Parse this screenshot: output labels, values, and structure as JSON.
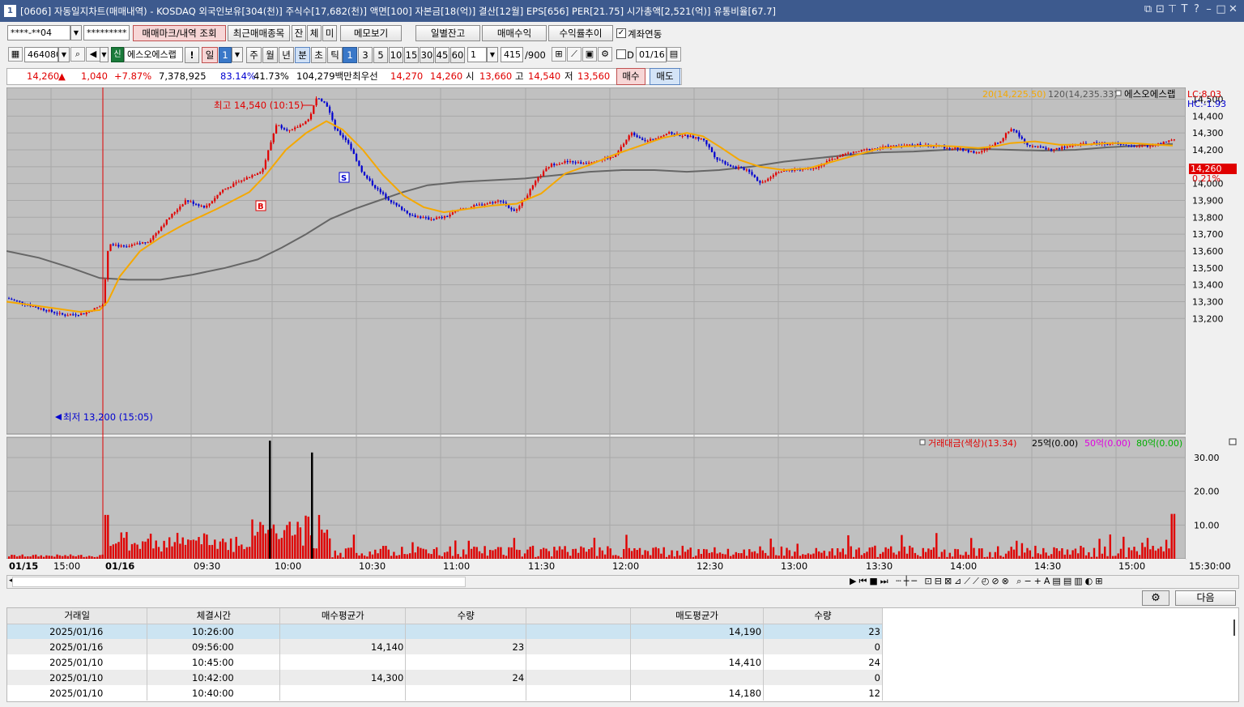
{
  "window": {
    "title": "[0606] 자동일지차트(매매내역) - KOSDAQ 외국인보유[304(천)] 주식수[17,682(천)] 액면[100] 자본금[18(억)] 결산[12월] EPS[656] PER[21.75] 시가총액[2,521(억)] 유통비율[67.7]",
    "app_icon": "1"
  },
  "toolbar1": {
    "account": "****-**04",
    "password": "*********",
    "btn_mark": "매매마크/내역 조회",
    "btn_recent": "최근매매종목",
    "btn_jan": "잔",
    "btn_che": "체",
    "btn_mi": "미",
    "btn_memo": "메모보기",
    "btn_daily": "일별잔고",
    "btn_profit": "매매수익",
    "btn_rate": "수익률추이",
    "chk_link": "계좌연동"
  },
  "toolbar2": {
    "code": "464080",
    "badge": "신",
    "name": "에스오에스랩",
    "excl": "!",
    "period_il": "일",
    "period_num": "1",
    "ju": "주",
    "wol": "월",
    "nyeon": "년",
    "bun": "분",
    "cho": "초",
    "tik": "틱",
    "intervals": [
      "1",
      "3",
      "5",
      "10",
      "15",
      "30",
      "45",
      "60"
    ],
    "mult": "1",
    "count": "415",
    "total": "/900",
    "d_label": "D",
    "date": "01/16"
  },
  "quote": {
    "price": "14,260",
    "updown": "▲",
    "change": "1,040",
    "pct": "+7.87%",
    "volume": "7,378,925",
    "ratio1": "83.14%",
    "ratio2": "41.73%",
    "amount": "104,279백만",
    "best_label": "최우선",
    "best_ask": "14,270",
    "best_bid": "14,260",
    "open_label": "시",
    "open": "13,660",
    "high_label": "고",
    "high": "14,540",
    "low_label": "저",
    "low": "13,560",
    "buy": "매수",
    "sell": "매도"
  },
  "chart": {
    "legend_ma20": "20(14,225.50)",
    "legend_ma120": "120(14,235.33)",
    "legend_name": "에스오에스랩",
    "lc": "LC:8.03",
    "hc": "HC:-1.93",
    "cur_price": "14,260",
    "cur_pct": "0.21%",
    "high_label": "최고 14,540 (10:15)",
    "low_label": "최저 13,200 (15:05)",
    "buy_mark": "B",
    "sell_mark": "S",
    "price_ticks": [
      "14,500",
      "14,400",
      "14,300",
      "14,200",
      "14,100",
      "14,000",
      "13,900",
      "13,800",
      "13,700",
      "13,600",
      "13,500",
      "13,400",
      "13,300",
      "13,200"
    ],
    "vol_legend": [
      "거래대금(색상)(13.34)",
      "25억(0.00)",
      "50억(0.00)",
      "80억(0.00)"
    ],
    "vol_ticks": [
      "30.00",
      "20.00",
      "10.00"
    ],
    "time_labels": [
      "01/15",
      "15:00",
      "01/16",
      "09:30",
      "10:00",
      "10:30",
      "11:00",
      "11:30",
      "12:00",
      "12:30",
      "13:00",
      "13:30",
      "14:00",
      "14:30",
      "15:00",
      "15:30:00"
    ],
    "colors": {
      "up": "#e00000",
      "down": "#0000d0",
      "ma20": "#f5a800",
      "ma120": "#666666",
      "bg": "#c0c0c0"
    }
  },
  "bottom": {
    "next": "다음"
  },
  "table": {
    "headers": [
      "거래일",
      "체결시간",
      "매수평균가",
      "수량",
      "",
      "매도평균가",
      "수량"
    ],
    "rows": [
      [
        "2025/01/16",
        "10:26:00",
        "",
        "",
        "",
        "14,190",
        "23"
      ],
      [
        "2025/01/16",
        "09:56:00",
        "14,140",
        "23",
        "",
        "",
        "0"
      ],
      [
        "2025/01/10",
        "10:45:00",
        "",
        "",
        "",
        "14,410",
        "24"
      ],
      [
        "2025/01/10",
        "10:42:00",
        "14,300",
        "24",
        "",
        "",
        "0"
      ],
      [
        "2025/01/10",
        "10:40:00",
        "",
        "",
        "",
        "14,180",
        "12"
      ]
    ]
  },
  "chart_data": {
    "type": "candlestick",
    "title": "에스오에스랩",
    "price_ylim": [
      13150,
      14560
    ],
    "volume_ylim": [
      0,
      36
    ],
    "close_series": [
      [
        0,
        13320
      ],
      [
        40,
        13260
      ],
      [
        70,
        13220
      ],
      [
        95,
        13230
      ],
      [
        118,
        13280
      ],
      [
        125,
        13650
      ],
      [
        145,
        13620
      ],
      [
        175,
        13660
      ],
      [
        200,
        13800
      ],
      [
        220,
        13900
      ],
      [
        245,
        13860
      ],
      [
        265,
        13960
      ],
      [
        290,
        14020
      ],
      [
        315,
        14080
      ],
      [
        332,
        14350
      ],
      [
        350,
        14310
      ],
      [
        372,
        14380
      ],
      [
        383,
        14520
      ],
      [
        395,
        14460
      ],
      [
        405,
        14320
      ],
      [
        420,
        14250
      ],
      [
        440,
        14050
      ],
      [
        460,
        13950
      ],
      [
        480,
        13870
      ],
      [
        500,
        13810
      ],
      [
        520,
        13790
      ],
      [
        540,
        13800
      ],
      [
        560,
        13850
      ],
      [
        590,
        13880
      ],
      [
        610,
        13900
      ],
      [
        625,
        13830
      ],
      [
        640,
        13920
      ],
      [
        655,
        14030
      ],
      [
        670,
        14110
      ],
      [
        690,
        14130
      ],
      [
        710,
        14120
      ],
      [
        730,
        14140
      ],
      [
        750,
        14160
      ],
      [
        770,
        14300
      ],
      [
        790,
        14250
      ],
      [
        815,
        14300
      ],
      [
        840,
        14280
      ],
      [
        860,
        14260
      ],
      [
        875,
        14150
      ],
      [
        895,
        14100
      ],
      [
        915,
        14080
      ],
      [
        930,
        14000
      ],
      [
        950,
        14070
      ],
      [
        970,
        14080
      ],
      [
        1000,
        14100
      ],
      [
        1030,
        14170
      ],
      [
        1060,
        14200
      ],
      [
        1090,
        14220
      ],
      [
        1120,
        14230
      ],
      [
        1150,
        14220
      ],
      [
        1180,
        14200
      ],
      [
        1200,
        14180
      ],
      [
        1225,
        14250
      ],
      [
        1240,
        14330
      ],
      [
        1260,
        14230
      ],
      [
        1290,
        14200
      ],
      [
        1320,
        14230
      ],
      [
        1350,
        14240
      ],
      [
        1375,
        14230
      ],
      [
        1400,
        14220
      ],
      [
        1420,
        14230
      ],
      [
        1440,
        14260
      ]
    ],
    "ma20": [
      [
        0,
        13300
      ],
      [
        30,
        13280
      ],
      [
        60,
        13260
      ],
      [
        90,
        13240
      ],
      [
        115,
        13250
      ],
      [
        125,
        13300
      ],
      [
        140,
        13450
      ],
      [
        165,
        13600
      ],
      [
        190,
        13680
      ],
      [
        220,
        13760
      ],
      [
        260,
        13850
      ],
      [
        300,
        13950
      ],
      [
        320,
        14050
      ],
      [
        345,
        14200
      ],
      [
        370,
        14300
      ],
      [
        395,
        14370
      ],
      [
        415,
        14320
      ],
      [
        440,
        14200
      ],
      [
        465,
        14050
      ],
      [
        490,
        13930
      ],
      [
        515,
        13860
      ],
      [
        540,
        13830
      ],
      [
        570,
        13850
      ],
      [
        600,
        13870
      ],
      [
        630,
        13880
      ],
      [
        660,
        13940
      ],
      [
        690,
        14060
      ],
      [
        720,
        14110
      ],
      [
        750,
        14170
      ],
      [
        780,
        14220
      ],
      [
        810,
        14270
      ],
      [
        840,
        14300
      ],
      [
        860,
        14280
      ],
      [
        880,
        14220
      ],
      [
        905,
        14140
      ],
      [
        930,
        14100
      ],
      [
        960,
        14080
      ],
      [
        990,
        14090
      ],
      [
        1020,
        14130
      ],
      [
        1050,
        14170
      ],
      [
        1080,
        14210
      ],
      [
        1110,
        14220
      ],
      [
        1140,
        14225
      ],
      [
        1170,
        14220
      ],
      [
        1200,
        14210
      ],
      [
        1220,
        14220
      ],
      [
        1240,
        14240
      ],
      [
        1270,
        14250
      ],
      [
        1300,
        14230
      ],
      [
        1330,
        14230
      ],
      [
        1360,
        14240
      ],
      [
        1390,
        14240
      ],
      [
        1420,
        14230
      ],
      [
        1440,
        14225
      ]
    ],
    "ma120": [
      [
        0,
        13600
      ],
      [
        40,
        13560
      ],
      [
        80,
        13500
      ],
      [
        115,
        13440
      ],
      [
        150,
        13430
      ],
      [
        190,
        13430
      ],
      [
        230,
        13460
      ],
      [
        270,
        13500
      ],
      [
        310,
        13550
      ],
      [
        340,
        13620
      ],
      [
        370,
        13700
      ],
      [
        400,
        13790
      ],
      [
        430,
        13850
      ],
      [
        460,
        13900
      ],
      [
        490,
        13950
      ],
      [
        520,
        13990
      ],
      [
        560,
        14010
      ],
      [
        600,
        14020
      ],
      [
        640,
        14030
      ],
      [
        680,
        14050
      ],
      [
        720,
        14070
      ],
      [
        760,
        14080
      ],
      [
        800,
        14080
      ],
      [
        840,
        14070
      ],
      [
        880,
        14080
      ],
      [
        920,
        14100
      ],
      [
        960,
        14130
      ],
      [
        1000,
        14150
      ],
      [
        1040,
        14170
      ],
      [
        1080,
        14185
      ],
      [
        1120,
        14190
      ],
      [
        1160,
        14200
      ],
      [
        1200,
        14205
      ],
      [
        1240,
        14200
      ],
      [
        1280,
        14195
      ],
      [
        1320,
        14200
      ],
      [
        1360,
        14215
      ],
      [
        1400,
        14225
      ],
      [
        1440,
        14235
      ]
    ]
  }
}
